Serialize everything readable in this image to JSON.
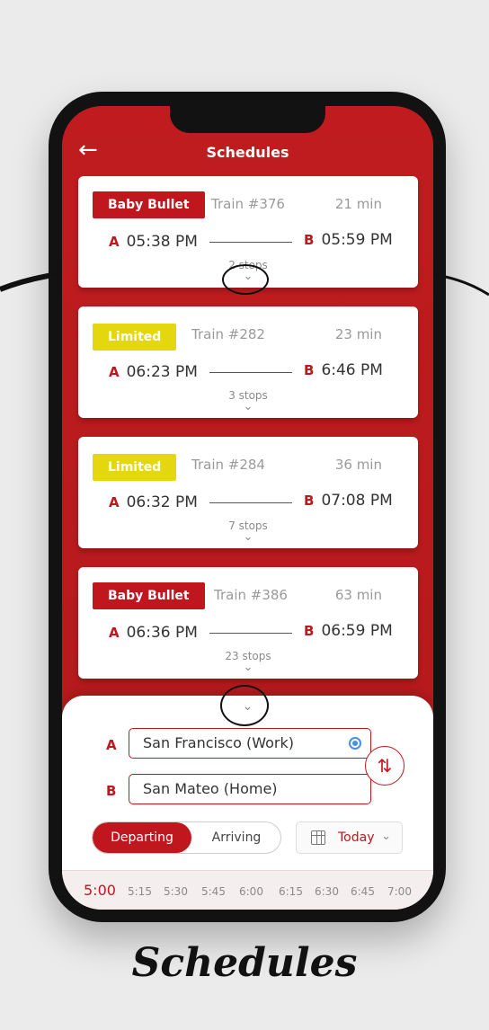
{
  "header": {
    "back_icon": "←",
    "title": "Schedules"
  },
  "trains": [
    {
      "badge": "Baby Bullet",
      "badge_color": "#c0161d",
      "train_no": "Train #376",
      "duration": "21 min",
      "from_point": "A",
      "depart": "05:38 PM",
      "to_point": "B",
      "arrive": "05:59 PM",
      "stops": "2 stops"
    },
    {
      "badge": "Limited",
      "badge_color": "#e4d70d",
      "train_no": "Train #282",
      "duration": "23 min",
      "from_point": "A",
      "depart": "06:23 PM",
      "to_point": "B",
      "arrive": "6:46 PM",
      "stops": "3 stops"
    },
    {
      "badge": "Limited",
      "badge_color": "#e4d70d",
      "train_no": "Train #284",
      "duration": "36 min",
      "from_point": "A",
      "depart": "06:32 PM",
      "to_point": "B",
      "arrive": "07:08 PM",
      "stops": "7 stops"
    },
    {
      "badge": "Baby Bullet",
      "badge_color": "#c0161d",
      "train_no": "Train #386",
      "duration": "63 min",
      "from_point": "A",
      "depart": "06:36 PM",
      "to_point": "B",
      "arrive": "06:59 PM",
      "stops": "23 stops"
    }
  ],
  "panel": {
    "from_label": "A",
    "from_value": "San Francisco (Work)",
    "to_label": "B",
    "to_value": "San Mateo (Home)",
    "swap_icon": "⇅",
    "departing": "Departing",
    "arriving": "Arriving",
    "date": "Today",
    "selected_time": "5:00",
    "times": [
      "5:15",
      "5:30",
      "5:45",
      "6:00",
      "6:15",
      "6:30",
      "6:45",
      "7:00"
    ]
  },
  "footer": {
    "title": "Schedules"
  },
  "colors": {
    "accent": "#c0161d",
    "limited": "#e4d70d",
    "radio": "#4a8fe0"
  }
}
